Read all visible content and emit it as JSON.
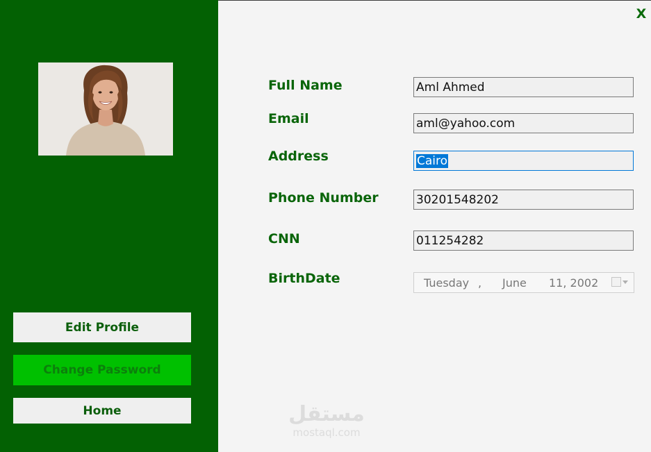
{
  "window": {
    "close_label": "X"
  },
  "sidebar": {
    "buttons": {
      "edit_profile": "Edit Profile",
      "change_password": "Change Password",
      "home": "Home"
    }
  },
  "form": {
    "full_name": {
      "label": "Full Name",
      "value": "Aml Ahmed"
    },
    "email": {
      "label": "Email",
      "value": "aml@yahoo.com"
    },
    "address": {
      "label": "Address",
      "value": "Cairo"
    },
    "phone": {
      "label": "Phone Number",
      "value": "30201548202"
    },
    "cnn": {
      "label": "CNN",
      "value": "011254282"
    },
    "birthdate": {
      "label": "BirthDate",
      "weekday": "Tuesday",
      "sep": ",",
      "month": "June",
      "day_year": "11, 2002"
    }
  },
  "watermark": {
    "arabic": "مستقل",
    "latin": "mostaql.com"
  },
  "colors": {
    "sidebar": "#036103",
    "accent_button": "#00c000",
    "label": "#0a650a"
  }
}
